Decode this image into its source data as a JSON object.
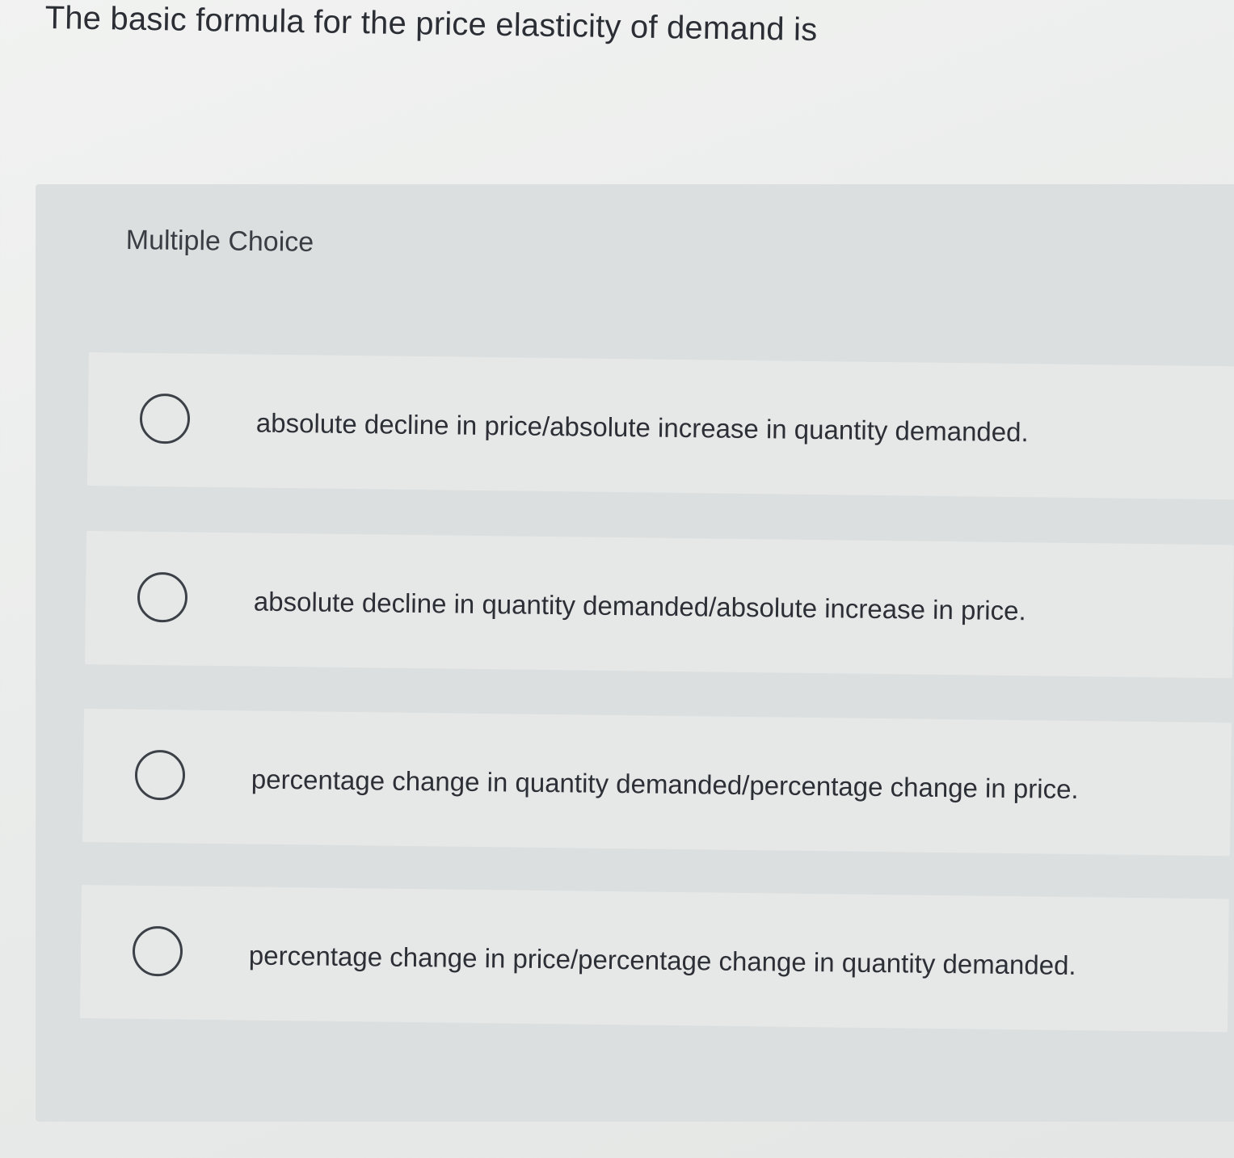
{
  "question": {
    "text": "The basic formula for the price elasticity of demand is"
  },
  "multiple_choice": {
    "label": "Multiple Choice",
    "options": [
      {
        "text": "absolute decline in price/absolute increase in quantity demanded.",
        "selected": false
      },
      {
        "text": "absolute decline in quantity demanded/absolute increase in price.",
        "selected": false
      },
      {
        "text": "percentage change in quantity demanded/percentage change in price.",
        "selected": false
      },
      {
        "text": "percentage change in price/percentage change in quantity demanded.",
        "selected": false
      }
    ]
  },
  "colors": {
    "background": "#eceeed",
    "panel": "#dcdfdf",
    "option_card": "#e6e8e8",
    "text": "#2c3036",
    "radio_border": "#3c4047"
  }
}
